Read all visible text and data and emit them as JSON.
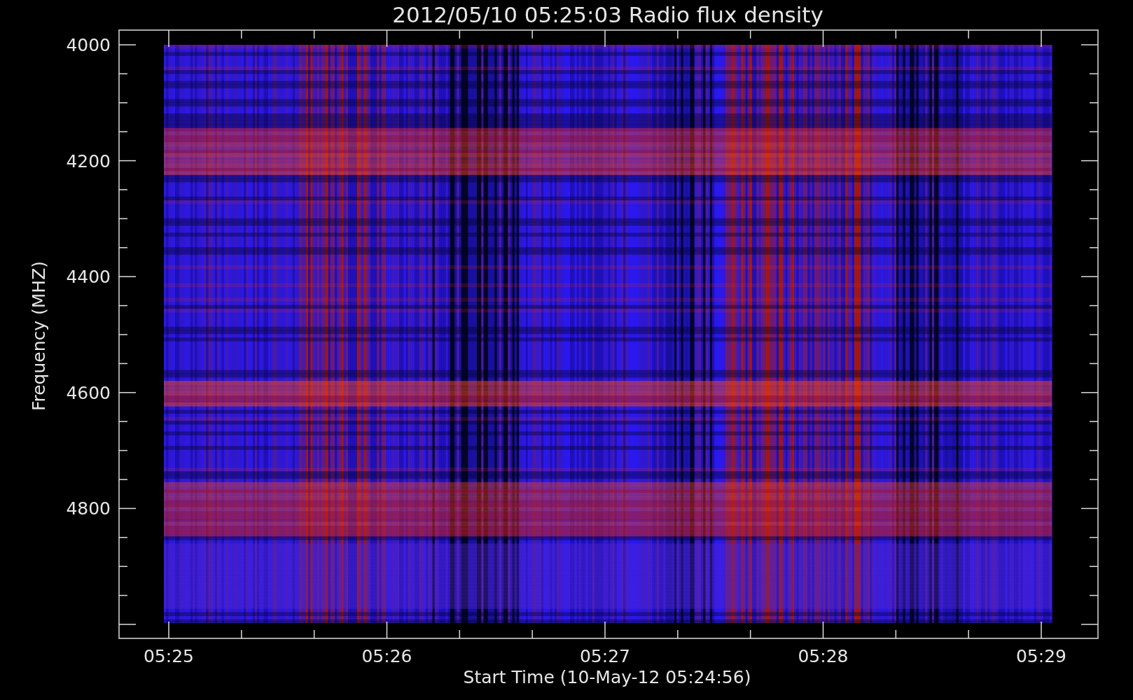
{
  "title": "2012/05/10 05:25:03 Radio flux density",
  "y_axis": {
    "label": "Frequency (MHZ)",
    "tick_labels": [
      "4000",
      "4200",
      "4400",
      "4600",
      "4800"
    ]
  },
  "x_axis": {
    "label": "Start Time (10-May-12 05:24:56)",
    "tick_labels": [
      "05:25",
      "05:26",
      "05:27",
      "05:28",
      "05:29"
    ]
  }
}
